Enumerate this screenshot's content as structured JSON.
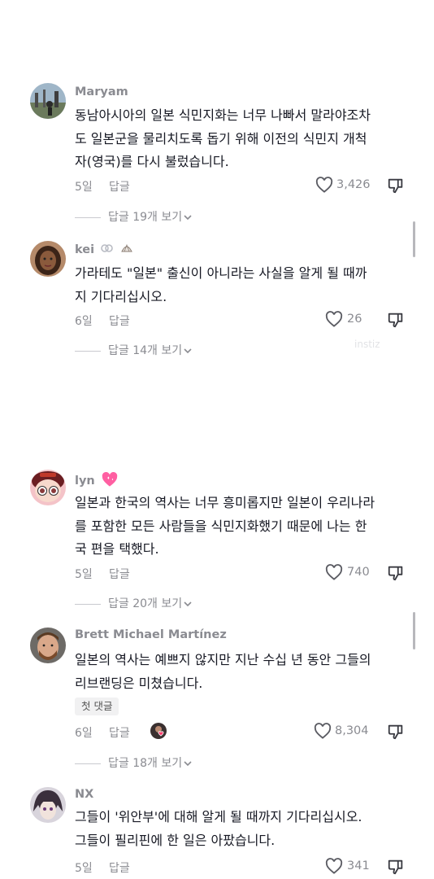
{
  "comments": [
    {
      "username": "Maryam",
      "lines": [
        "동남아시아의 일본 식민지화는 너무 나빠서 말라야조차",
        "도 일본군을 물리치도록 돕기 위해 이전의 식민지 개척",
        "자(영국)를 다시 불렀습니다."
      ],
      "date": "5일",
      "reply_label": "답글",
      "likes": "3,426",
      "view_replies": "답글 19개 보기"
    },
    {
      "username": "kei",
      "lines": [
        "가라테도 \"일본\" 출신이 아니라는 사실을 알게 될 때까",
        "지 기다리십시오."
      ],
      "date": "6일",
      "reply_label": "답글",
      "likes": "26",
      "view_replies": "답글 14개 보기"
    },
    {
      "username": "lyn",
      "lines": [
        "일본과 한국의 역사는 너무 흥미롭지만 일본이 우리나라",
        "를 포함한 모든 사람들을 식민지화했기 때문에 나는 한",
        "국 편을 택했다."
      ],
      "date": "5일",
      "reply_label": "답글",
      "likes": "740",
      "view_replies": "답글 20개 보기"
    },
    {
      "username": "Brett Michael Martínez",
      "lines": [
        "일본의 역사는 예쁘지 않지만 지난 수십 년 동안 그들의",
        "리브랜딩은 미쳤습니다."
      ],
      "badge": "첫 댓글",
      "date": "6일",
      "reply_label": "답글",
      "likes": "8,304",
      "view_replies": "답글 18개 보기"
    },
    {
      "username": "NX",
      "lines": [
        "그들이 '위안부'에 대해 알게 될 때까지 기다리십시오.",
        "그들이 필리핀에 한 일은 아팠습니다."
      ],
      "date": "5일",
      "reply_label": "답글",
      "likes": "341"
    }
  ],
  "watermark": "instiz",
  "colors": {
    "text": "#161823",
    "muted": "#8a8b91",
    "heart_pink": "#ff3b6b"
  }
}
